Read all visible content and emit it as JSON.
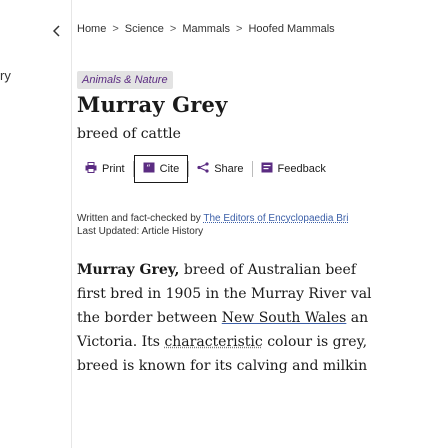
{
  "rail": {
    "fragment": "ry"
  },
  "breadcrumb": [
    "Home",
    "Science",
    "Mammals",
    "Hoofed Mammals"
  ],
  "breadcrumb_sep": ">",
  "badge": "Animals & Nature",
  "title": "Murray Grey",
  "subtitle": "breed of cattle",
  "actions": {
    "print": "Print",
    "cite": "Cite",
    "share": "Share",
    "feedback": "Feedback"
  },
  "byline": {
    "prefix": "Written and fact-checked by ",
    "authors": "The Editors of Encyclopaedia Bri"
  },
  "updated": "Last Updated: Article History",
  "article": {
    "l1_bold": "Murray Grey,",
    "l1_rest": " breed of Australian beef",
    "l2": "first bred in 1905 in the Murray River val",
    "l3_a": "the border between ",
    "l3_link": "New South Wales",
    "l3_b": " an",
    "l4_a": "Victoria. Its ",
    "l4_link": "characteristic",
    "l4_b": " colour is grey,",
    "l5": "breed is known for its calving and milkin"
  }
}
